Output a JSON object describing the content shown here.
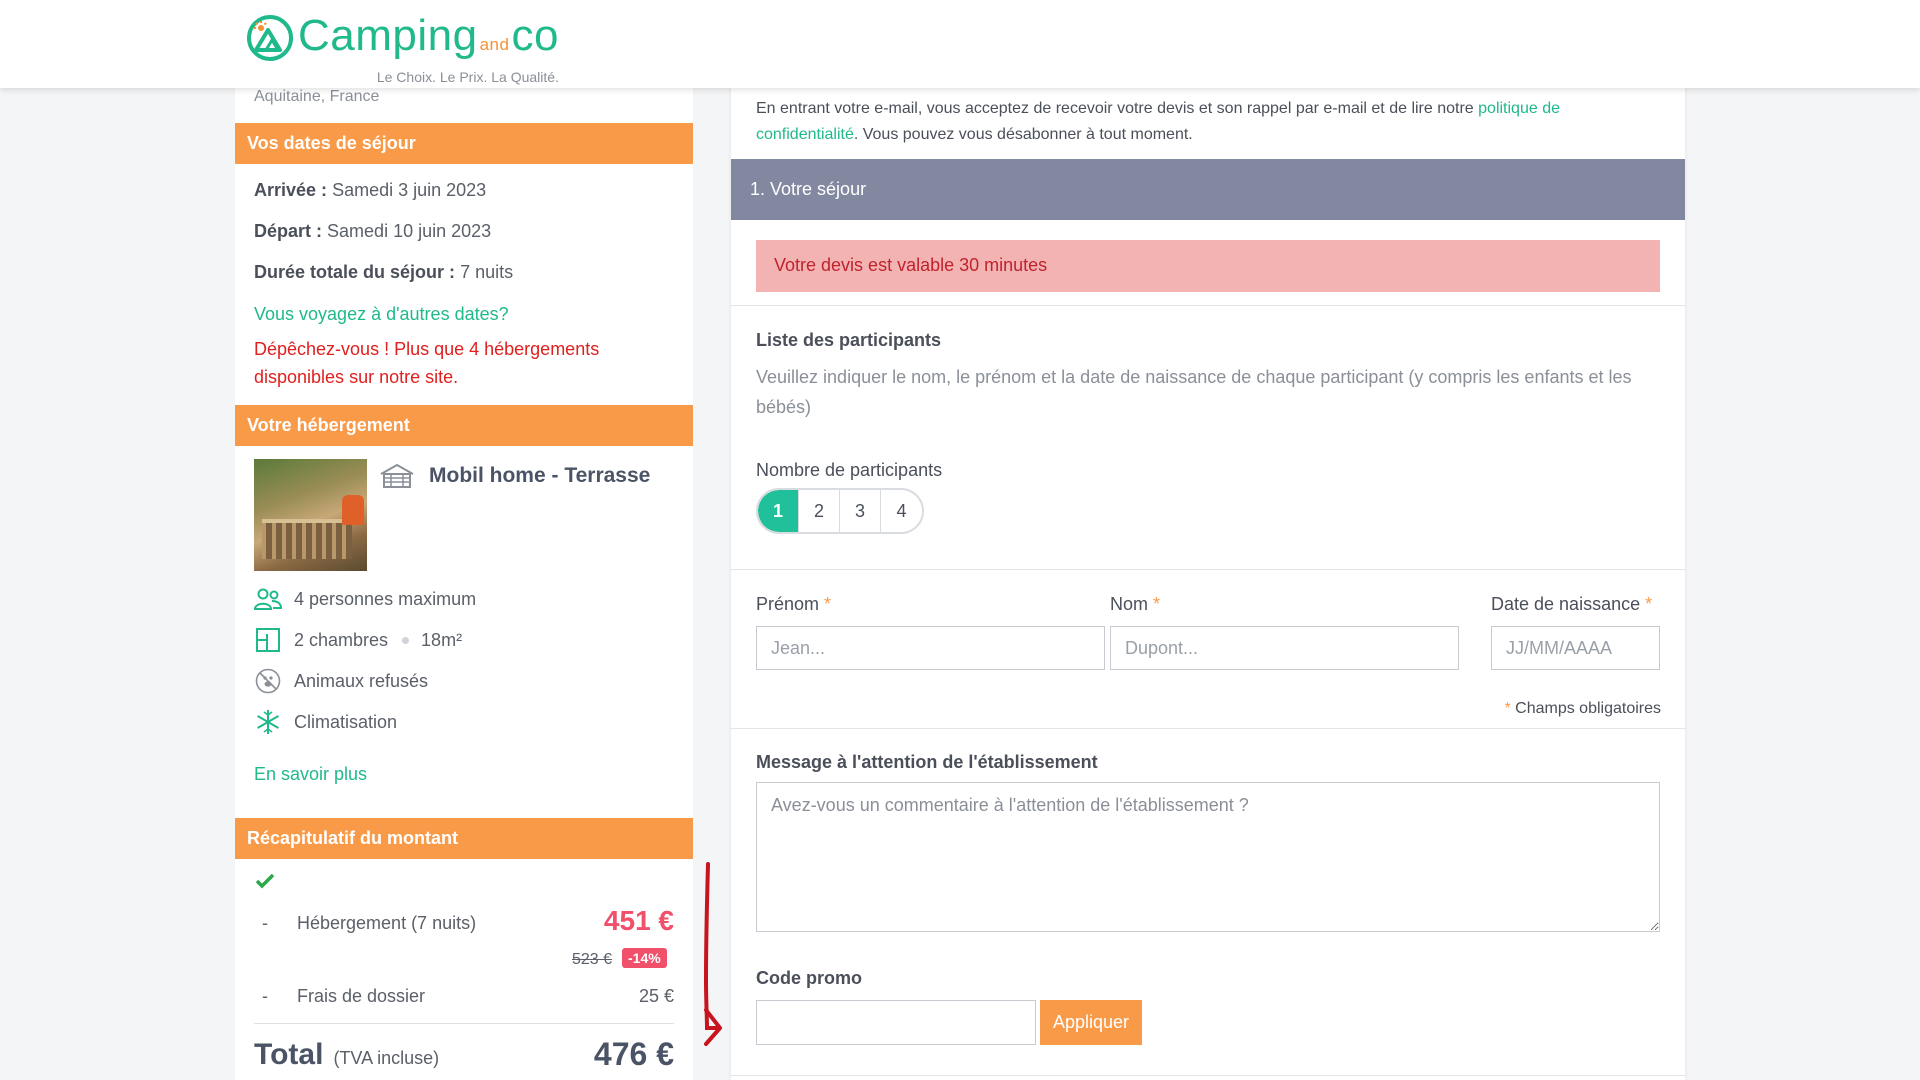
{
  "header": {
    "logo_main": "Camping",
    "logo_and": "and",
    "logo_co": "co",
    "tagline": "Le Choix. Le Prix. La Qualité."
  },
  "sidebar": {
    "location": "Aquitaine, France",
    "dates_title": "Vos dates de séjour",
    "arrival_label": "Arrivée :",
    "arrival_value": "Samedi 3 juin 2023",
    "departure_label": "Départ :",
    "departure_value": "Samedi 10 juin 2023",
    "duration_label": "Durée totale du séjour :",
    "duration_value": "7 nuits",
    "other_dates_link": "Vous voyagez à d'autres dates?",
    "hurry_line1": "Dépêchez-vous ! Plus que 4 hébergements",
    "hurry_line2": "disponibles sur notre site.",
    "accommodation_title": "Votre hébergement",
    "accommodation_name": "Mobil home - Terrasse",
    "features": {
      "capacity": "4 personnes maximum",
      "rooms": "2 chambres",
      "area": "18m²",
      "pets": "Animaux refusés",
      "aircon": "Climatisation"
    },
    "learn_more": "En savoir plus",
    "summary_title": "Récapitulatif du montant",
    "summary": {
      "dash": "-",
      "lodging_label": "Hébergement (7 nuits)",
      "lodging_price": "451 €",
      "old_price": "523 €",
      "discount": "-14%",
      "fees_label": "Frais de dossier",
      "fees_price": "25 €",
      "total_label": "Total",
      "total_note": "(TVA incluse)",
      "total_price": "476 €"
    }
  },
  "main": {
    "consent_text": "En entrant votre e-mail, vous acceptez de recevoir votre devis et son rappel par e-mail et de lire notre ",
    "consent_link": "politique de confidentialité",
    "consent_after": ". Vous pouvez vous désabonner à tout moment.",
    "step_title": "1. Votre séjour",
    "alert": "Votre devis est valable 30 minutes",
    "participants_title": "Liste des participants",
    "participants_help": "Veuillez indiquer le nom, le prénom et la date de naissance de chaque participant (y compris les enfants et les bébés)",
    "count_label": "Nombre de participants",
    "count_options": [
      "1",
      "2",
      "3",
      "4"
    ],
    "count_selected": "1",
    "firstname_label": "Prénom",
    "lastname_label": "Nom",
    "birthdate_label": "Date de naissance",
    "asterisk": "*",
    "firstname_placeholder": "Jean...",
    "lastname_placeholder": "Dupont...",
    "birthdate_placeholder": "JJ/MM/AAAA",
    "required_note": "Champs obligatoires",
    "message_title": "Message à l'attention de l'établissement",
    "message_placeholder": "Avez-vous un commentaire à l'attention de l'établissement ?",
    "promo_title": "Code promo",
    "promo_value": "",
    "apply_label": "Appliquer"
  },
  "colors": {
    "brand_green": "#20b98c",
    "brand_orange": "#f99a48",
    "price_red": "#f0506a",
    "step_header": "#8288a0",
    "alert_bg": "#f3b3b3"
  }
}
